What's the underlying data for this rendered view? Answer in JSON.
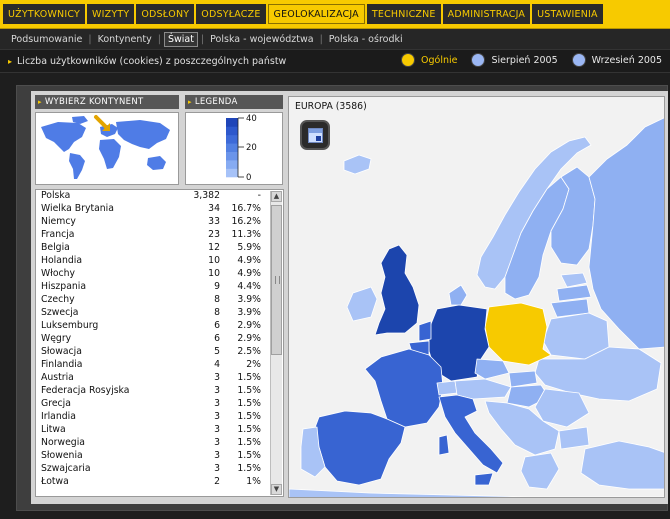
{
  "nav": {
    "tabs": [
      {
        "label": "UŻYTKOWNICY"
      },
      {
        "label": "WIZYTY"
      },
      {
        "label": "ODSŁONY"
      },
      {
        "label": "ODSYŁACZE"
      },
      {
        "label": "GEOLOKALIZACJA",
        "active": true
      },
      {
        "label": "TECHNICZNE"
      },
      {
        "label": "ADMINISTRACJA"
      },
      {
        "label": "USTAWIENIA"
      }
    ]
  },
  "subnav": {
    "tabs": [
      {
        "label": "Podsumowanie"
      },
      {
        "label": "Kontynenty"
      },
      {
        "label": "Świat",
        "active": true
      },
      {
        "label": "Polska - województwa"
      },
      {
        "label": "Polska - ośrodki"
      }
    ]
  },
  "info": {
    "title": "Liczba użytkowników (cookies) z poszczególnych państw",
    "options": [
      {
        "label": "Ogólnie",
        "selected": true,
        "color": "#f7ca00"
      },
      {
        "label": "Sierpień 2005",
        "color": "#9bb7f4"
      },
      {
        "label": "Wrzesień 2005",
        "color": "#9bb7f4"
      }
    ]
  },
  "continent_panel": {
    "title": "WYBIERZ KONTYNENT"
  },
  "legend_panel": {
    "title": "LEGENDA",
    "ticks": [
      "40",
      "20",
      "0"
    ],
    "colors": [
      "#1f45b8",
      "#2d58cc",
      "#3d6ad8",
      "#5280e2",
      "#6a94ea",
      "#86abf2",
      "#a6c2f8"
    ]
  },
  "table": {
    "rows": [
      {
        "name": "Polska",
        "count": "3,382",
        "pct": "-"
      },
      {
        "name": "Wielka Brytania",
        "count": "34",
        "pct": "16.7%"
      },
      {
        "name": "Niemcy",
        "count": "33",
        "pct": "16.2%"
      },
      {
        "name": "Francja",
        "count": "23",
        "pct": "11.3%"
      },
      {
        "name": "Belgia",
        "count": "12",
        "pct": "5.9%"
      },
      {
        "name": "Holandia",
        "count": "10",
        "pct": "4.9%"
      },
      {
        "name": "Włochy",
        "count": "10",
        "pct": "4.9%"
      },
      {
        "name": "Hiszpania",
        "count": "9",
        "pct": "4.4%"
      },
      {
        "name": "Czechy",
        "count": "8",
        "pct": "3.9%"
      },
      {
        "name": "Szwecja",
        "count": "8",
        "pct": "3.9%"
      },
      {
        "name": "Luksemburg",
        "count": "6",
        "pct": "2.9%"
      },
      {
        "name": "Węgry",
        "count": "6",
        "pct": "2.9%"
      },
      {
        "name": "Słowacja",
        "count": "5",
        "pct": "2.5%"
      },
      {
        "name": "Finlandia",
        "count": "4",
        "pct": "2%"
      },
      {
        "name": "Austria",
        "count": "3",
        "pct": "1.5%"
      },
      {
        "name": "Federacja Rosyjska",
        "count": "3",
        "pct": "1.5%"
      },
      {
        "name": "Grecja",
        "count": "3",
        "pct": "1.5%"
      },
      {
        "name": "Irlandia",
        "count": "3",
        "pct": "1.5%"
      },
      {
        "name": "Litwa",
        "count": "3",
        "pct": "1.5%"
      },
      {
        "name": "Norwegia",
        "count": "3",
        "pct": "1.5%"
      },
      {
        "name": "Słowenia",
        "count": "3",
        "pct": "1.5%"
      },
      {
        "name": "Szwajcaria",
        "count": "3",
        "pct": "1.5%"
      },
      {
        "name": "Łotwa",
        "count": "2",
        "pct": "1%"
      }
    ]
  },
  "map": {
    "title": "EUROPA (3586)",
    "colors": {
      "highlight": "#f7ca00",
      "dark": "#1c45ad",
      "medium": "#3864d2",
      "light": "#8fb0f2",
      "lighter": "#a9c3f6",
      "sea": "#f2f2f2"
    }
  }
}
